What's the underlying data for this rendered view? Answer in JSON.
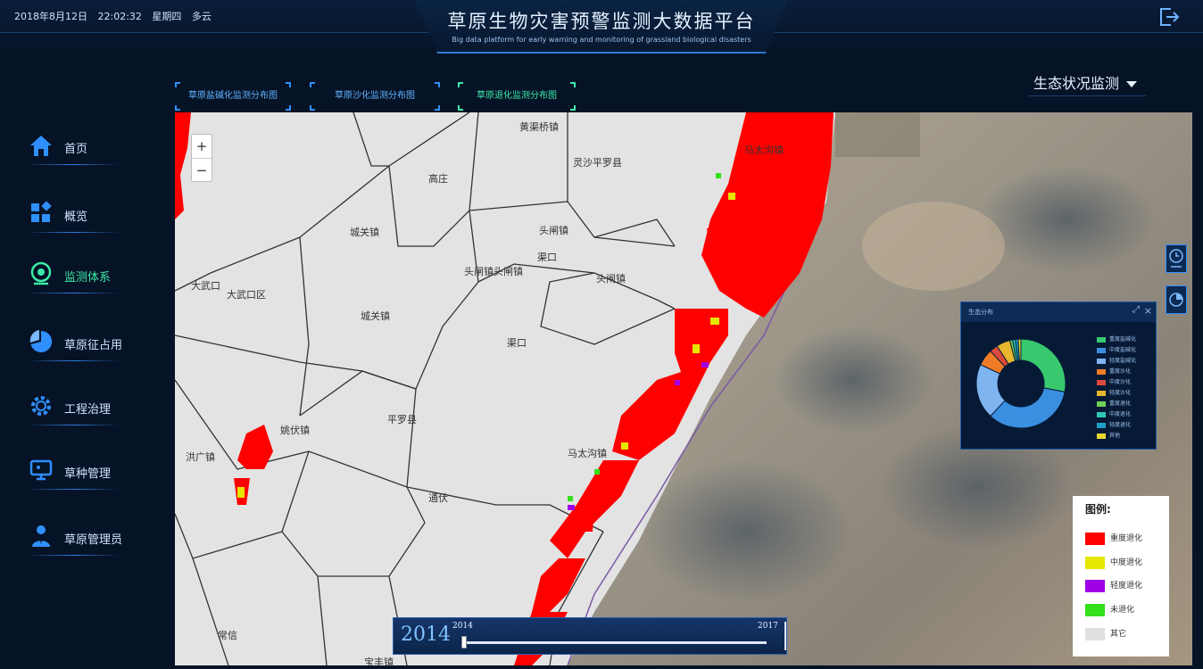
{
  "header": {
    "date": "2018年8月12日",
    "time": "22:02:32",
    "weekday": "星期四",
    "weather": "多云",
    "title": "草原生物灾害预警监测大数据平台",
    "subtitle": "Big data platform for early warning and monitoring of grassland biological disasters"
  },
  "sidebar": {
    "items": [
      {
        "label": "首页",
        "icon": "home-icon"
      },
      {
        "label": "概览",
        "icon": "overview-icon"
      },
      {
        "label": "监测体系",
        "icon": "monitor-icon"
      },
      {
        "label": "草原征占用",
        "icon": "pie-icon"
      },
      {
        "label": "工程治理",
        "icon": "gear-icon"
      },
      {
        "label": "草种管理",
        "icon": "screen-icon"
      },
      {
        "label": "草原管理员",
        "icon": "user-icon"
      }
    ],
    "active_index": 2
  },
  "tabs": [
    {
      "label": "草原盐碱化监测分布图"
    },
    {
      "label": "草原沙化监测分布图"
    },
    {
      "label": "草原退化监测分布图"
    }
  ],
  "dropdown": {
    "selected": "生态状况监测"
  },
  "map": {
    "zoom_in": "+",
    "zoom_out": "−",
    "places": [
      "黄渠桥镇",
      "马太沟镇",
      "灵沙平罗县",
      "高庄",
      "城关镇",
      "头闸镇",
      "渠口",
      "头闸镇",
      "头闸镇头闸镇",
      "大武口",
      "大武口区",
      "城关镇",
      "渠口",
      "平罗县",
      "姚伏镇",
      "马太沟镇",
      "洪广镇",
      "通伏",
      "常信",
      "宝丰镇"
    ]
  },
  "chart_panel": {
    "title": "生态分布",
    "close": "×",
    "expand": "⤢",
    "legend": [
      "重度盐碱化",
      "中度盐碱化",
      "轻度盐碱化",
      "重度沙化",
      "中度沙化",
      "轻度沙化",
      "重度退化",
      "中度退化",
      "轻度退化",
      "其他"
    ]
  },
  "chart_data": {
    "type": "pie",
    "title": "生态分布",
    "labels": [
      "重度盐碱化",
      "中度盐碱化",
      "轻度盐碱化",
      "重度沙化",
      "中度沙化",
      "轻度沙化",
      "重度退化",
      "中度退化",
      "轻度退化",
      "其他"
    ],
    "values": [
      28,
      34,
      20,
      6,
      3,
      5,
      1,
      1,
      1,
      1
    ],
    "colors": [
      "#38c96f",
      "#3a8fe0",
      "#7eb4f0",
      "#f07c28",
      "#d94a3a",
      "#e8b52f",
      "#6fd15a",
      "#2ec7b8",
      "#1ea0c8",
      "#e8d52f"
    ]
  },
  "legend": {
    "title": "图例:",
    "items": [
      {
        "label": "重度退化",
        "color": "#ff0000"
      },
      {
        "label": "中度退化",
        "color": "#e6e600"
      },
      {
        "label": "轻度退化",
        "color": "#a000e6"
      },
      {
        "label": "未退化",
        "color": "#33e01a"
      },
      {
        "label": "其它",
        "color": "#e0e0e0"
      }
    ]
  },
  "timeline": {
    "current_year": "2014",
    "start": "2014",
    "end": "2017",
    "progress": 0
  }
}
